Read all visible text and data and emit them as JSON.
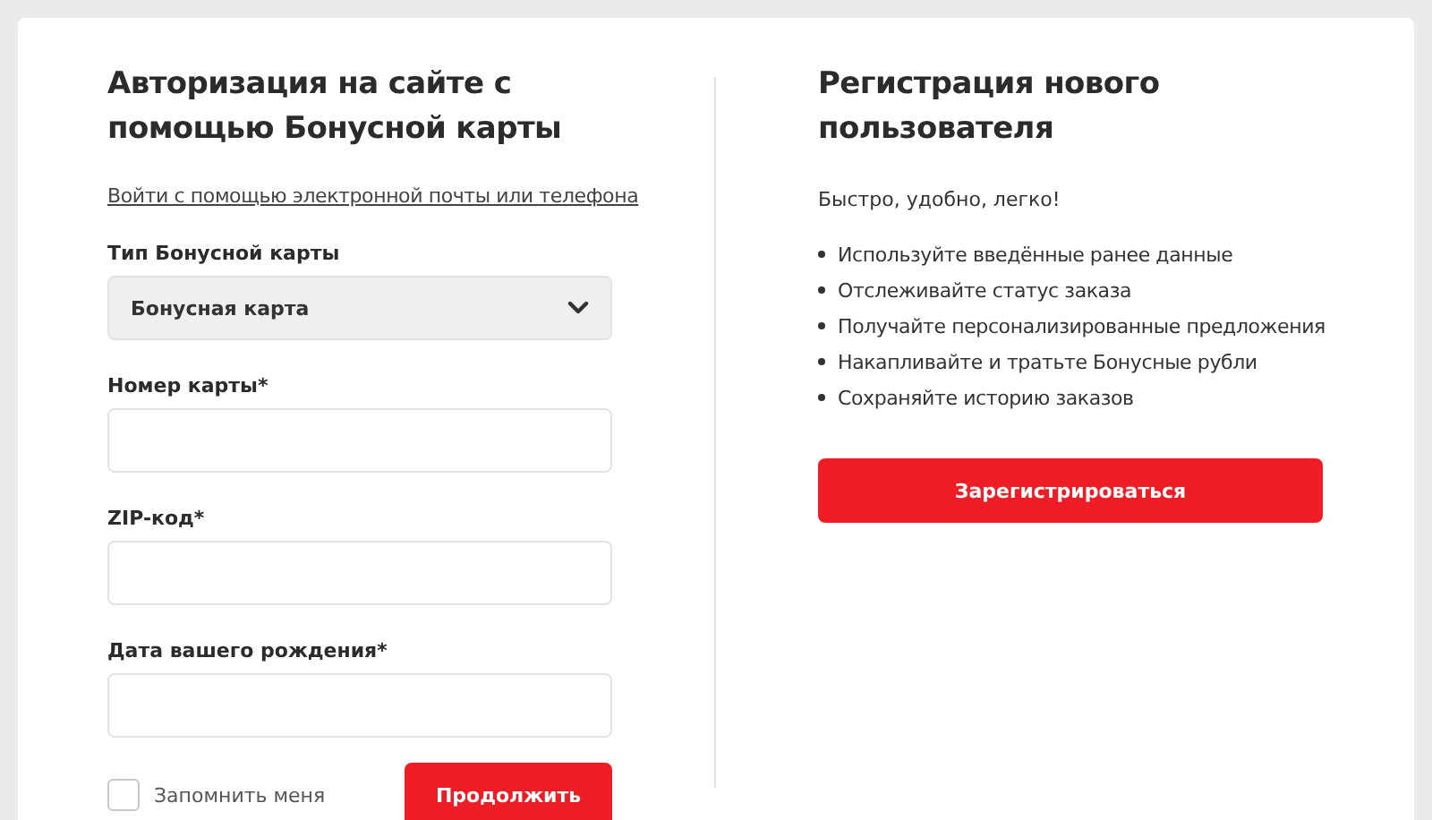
{
  "login": {
    "title": "Авторизация на сайте с помощью Бонусной карты",
    "alt_link": "Войти с помощью электронной почты или телефона",
    "card_type": {
      "label": "Тип Бонусной карты",
      "value": "Бонусная карта"
    },
    "fields": [
      {
        "label": "Номер карты*"
      },
      {
        "label": "ZIP-код*"
      },
      {
        "label": "Дата вашего рождения*"
      }
    ],
    "remember": {
      "label": "Запомнить меня",
      "checked": false
    },
    "submit": "Продолжить"
  },
  "register": {
    "title": "Регистрация нового пользователя",
    "subtitle": "Быстро, удобно, легко!",
    "benefits": [
      "Используйте введённые ранее данные",
      "Отслеживайте статус заказа",
      "Получайте персонализированные предложения",
      "Накапливайте и тратьте Бонусные рубли",
      "Сохраняйте историю заказов"
    ],
    "button": "Зарегистрироваться"
  }
}
